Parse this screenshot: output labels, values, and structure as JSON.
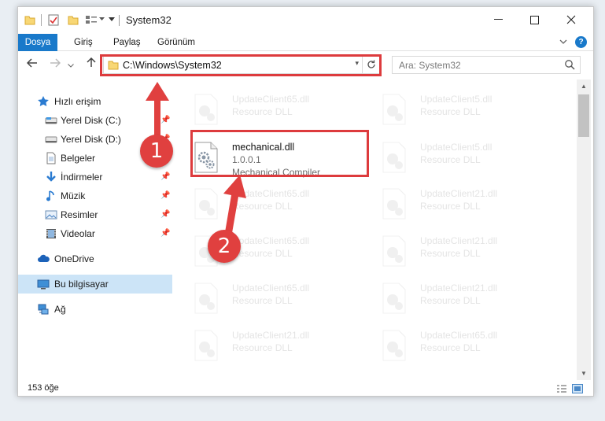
{
  "window": {
    "title": "System32"
  },
  "ribbon": {
    "tabs": [
      "Dosya",
      "Giriş",
      "Paylaş",
      "Görünüm"
    ]
  },
  "address_bar": {
    "path": "C:\\Windows\\System32"
  },
  "search": {
    "placeholder": "Ara: System32"
  },
  "sidebar": {
    "items": [
      {
        "label": "Hızlı erişim",
        "icon": "star-icon"
      },
      {
        "label": "Yerel Disk (C:)",
        "icon": "drive-icon",
        "pinned": true
      },
      {
        "label": "Yerel Disk (D:)",
        "icon": "drive-icon",
        "pinned": true
      },
      {
        "label": "Belgeler",
        "icon": "documents-icon",
        "pinned": true
      },
      {
        "label": "İndirmeler",
        "icon": "download-icon",
        "pinned": true
      },
      {
        "label": "Müzik",
        "icon": "music-icon",
        "pinned": true
      },
      {
        "label": "Resimler",
        "icon": "pictures-icon",
        "pinned": true
      },
      {
        "label": "Videolar",
        "icon": "videos-icon",
        "pinned": true
      },
      {
        "label": "OneDrive",
        "icon": "cloud-icon"
      },
      {
        "label": "Bu bilgisayar",
        "icon": "computer-icon",
        "selected": true
      },
      {
        "label": "Ağ",
        "icon": "network-icon"
      }
    ]
  },
  "files": {
    "highlighted": {
      "name": "mechanical.dll",
      "version": "1.0.0.1",
      "description": "Mechanical Compiler"
    },
    "faded": [
      {
        "name": "UpdateClient65.dll",
        "sub": "Resource DLL"
      },
      {
        "name": "UpdateClient5.dll",
        "sub": "Resource DLL"
      },
      {
        "name": "UpdateClient5.dll",
        "sub": "Resource DLL"
      },
      {
        "name": "UpdateClient65.dll",
        "sub": "Resource DLL"
      },
      {
        "name": "UpdateClient21.dll",
        "sub": "Resource DLL"
      },
      {
        "name": "UpdateClient65.dll",
        "sub": "Resource DLL"
      },
      {
        "name": "UpdateClient21.dll",
        "sub": "Resource DLL"
      },
      {
        "name": "UpdateClient65.dll",
        "sub": "Resource DLL"
      },
      {
        "name": "UpdateClient21.dll",
        "sub": "Resource DLL"
      },
      {
        "name": "UpdateClient21.dll",
        "sub": "Resource DLL"
      },
      {
        "name": "UpdateClient65.dll",
        "sub": "Resource DLL"
      }
    ]
  },
  "status": {
    "item_count": "153 öğe"
  },
  "annotations": {
    "step1": "1",
    "step2": "2",
    "color": "#dd3b3d"
  }
}
